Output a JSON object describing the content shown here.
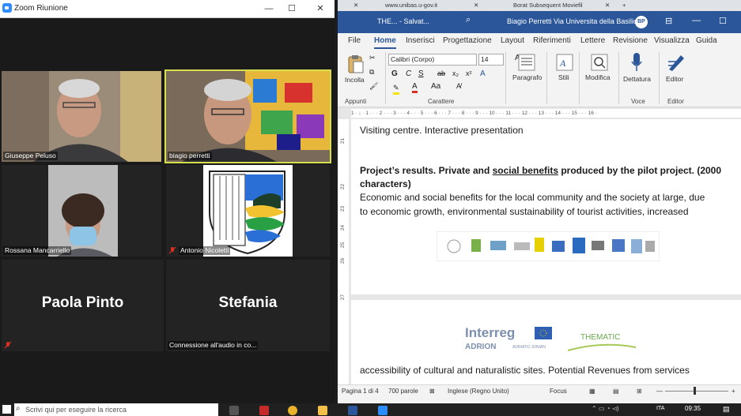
{
  "zoom": {
    "title": "Zoom Riunione",
    "window_controls": [
      "—",
      "☐",
      "✕"
    ],
    "participants": [
      {
        "name": "Giuseppe Peluso",
        "kind": "video"
      },
      {
        "name": "biagio perretti",
        "kind": "video",
        "active_speaker": true
      },
      {
        "name": "Rossana Mancarriello",
        "kind": "video"
      },
      {
        "name": "Antonio Nicoletti",
        "kind": "logo",
        "muted": true
      },
      {
        "name": "Paola Pinto",
        "kind": "name-only",
        "muted": true
      },
      {
        "name": "Stefania",
        "kind": "name-only",
        "status": "Connessione all'audio in co..."
      }
    ]
  },
  "browser": {
    "tabs": [
      "www.unibas.u-gov.it",
      "Borat Subsequent Moviefil"
    ]
  },
  "word": {
    "title_left": "THE... - Salvat...",
    "title_user": "Biagio Perretti Via Universita della Basilicata",
    "avatar": "BP",
    "menu": [
      "File",
      "Home",
      "Inserisci",
      "Progettazione",
      "Layout",
      "Riferimenti",
      "Lettere",
      "Revisione",
      "Visualizza",
      "Guida"
    ],
    "active_menu": "Home",
    "ribbon": {
      "clipboard_button": "Incolla",
      "clipboard_group": "Appunti",
      "font_name": "Calibri (Corpo)",
      "font_size": "14",
      "font_group": "Carattere",
      "paragraph_button": "Paragrafo",
      "styles_button": "Stili",
      "editing_button": "Modifica",
      "dictate_button": "Dettatura",
      "voice_group": "Voce",
      "editor_button": "Editor",
      "editor_group": "Editor",
      "format_buttons": [
        "G",
        "C",
        "S",
        "ab",
        "x₂",
        "x²",
        "A",
        "Aa"
      ]
    },
    "ruler_numbers": "1 · ↓ · 1 · · · 2 · · · 3 · · · 4 · · · 5 · · · 6 · · · 7 · · · 8 · · · 9 · · · 10 · · · 11 · · · 12 · · · 13 · · · 14 · · · 15 · · · 16 ·",
    "left_ruler": [
      "21",
      "22",
      "23",
      "24",
      "25",
      "26",
      "27"
    ],
    "doc": {
      "line1": "Visiting centre. Interactive presentation",
      "heading_a": "Project’s results. Private and ",
      "heading_b": "social  benefits",
      "heading_c": " produced by the pilot project. (2000",
      "heading_d": "characters)",
      "body1": "Economic and social benefits for the local community and the society at large, due",
      "body2": "to economic growth, environmental sustainability of tourist activities, increased",
      "body3": "accessibility of cultural and naturalistic sites. Potential Revenues from services",
      "footer_logo1": "Interreg",
      "footer_logo1_sub": "ADRION",
      "footer_logo1_sub2": "ADRIATIC-IONIAN",
      "footer_logo2": "THEMATIC"
    },
    "status": {
      "page": "Pagina 1 di 4",
      "words": "700 parole",
      "language": "Inglese (Regno Unito)",
      "focus": "Focus"
    }
  },
  "taskbar": {
    "search_placeholder": "Scrivi qui per eseguire la ricerca",
    "time": "09:35",
    "lang": "ITA"
  },
  "colors": {
    "word_blue": "#2b579a",
    "active_speaker_border": "#d6e04a",
    "mute_red": "#d93025"
  }
}
